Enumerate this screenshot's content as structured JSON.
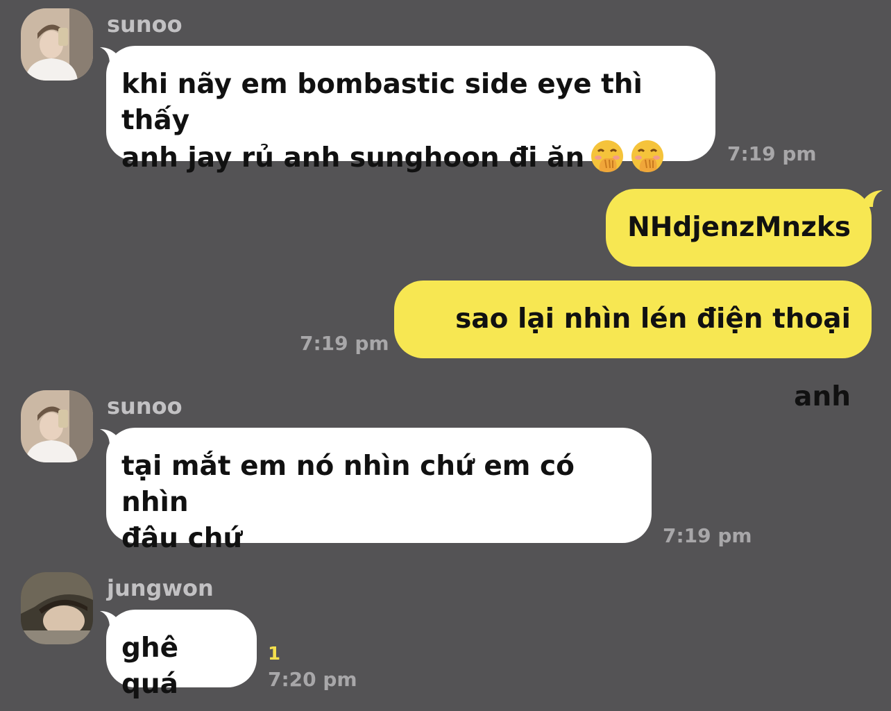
{
  "messages": [
    {
      "sender": "sunoo",
      "lines": [
        "khi nãy em bombastic side eye thì thấy",
        "anh jay rủ anh sunghoon đi ăn"
      ],
      "emoji": [
        "hand-over-mouth-emoji",
        "hand-over-mouth-emoji"
      ],
      "time": "7:19 pm"
    },
    {
      "text": "NHdjenzMnzks"
    },
    {
      "text": "sao lại nhìn lén điện thoại anh",
      "time": "7:19 pm"
    },
    {
      "sender": "sunoo",
      "lines": [
        "tại mắt em nó nhìn chứ em có nhìn",
        "đâu chứ"
      ],
      "time": "7:19 pm"
    },
    {
      "sender": "jungwon",
      "lines": [
        "ghê quá"
      ],
      "unread": "1",
      "time": "7:20 pm"
    }
  ],
  "colors": {
    "background": "#545355",
    "incoming_bubble": "#ffffff",
    "outgoing_bubble": "#f7e752",
    "unread_count": "#f4e04d"
  }
}
